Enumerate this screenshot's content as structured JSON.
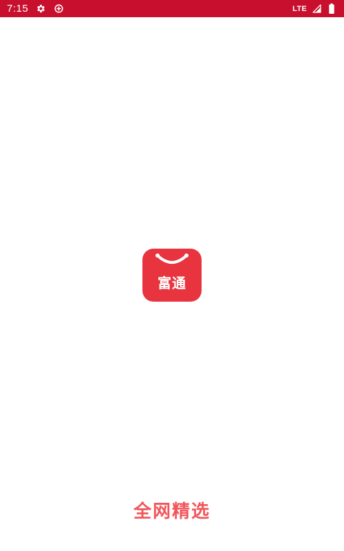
{
  "status_bar": {
    "time": "7:15",
    "left_icons": [
      "gear-icon",
      "data-saver-icon"
    ],
    "network": "LTE",
    "right_icons": [
      "signal-icon",
      "battery-icon"
    ],
    "color": "#c8102e"
  },
  "splash": {
    "app_logo_text": "富通",
    "logo_color": "#e8343e",
    "slogan": "全网精选",
    "slogan_color": "#f2555a"
  }
}
